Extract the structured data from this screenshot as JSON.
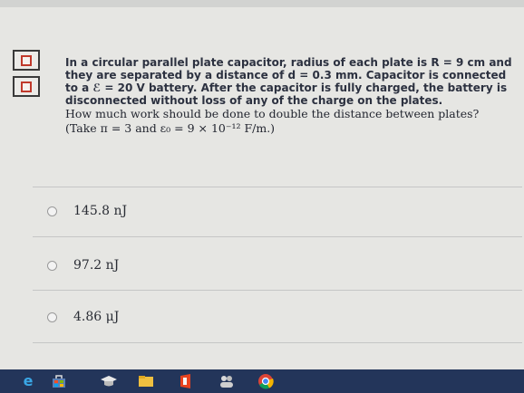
{
  "question": {
    "lines": [
      "In a circular parallel plate capacitor, radius of each plate is R = 9 cm and",
      "they are separated by a distance of d = 0.3 mm. Capacitor is connected",
      "to a ℰ = 20 V battery. After the capacitor is fully charged, the battery is",
      "disconnected without loss of any of the charge on the plates.",
      "How much work should be done to double the distance between plates?",
      "(Take π = 3 and ε₀ = 9 × 10⁻¹² F/m.)"
    ]
  },
  "options": [
    {
      "label": "145.8 nJ"
    },
    {
      "label": "97.2 nJ"
    },
    {
      "label": "4.86 μJ"
    }
  ],
  "taskbar": {
    "icons": [
      "edge-icon",
      "store-icon",
      "graduation-cap-icon",
      "file-explorer-icon",
      "office-icon",
      "people-icon",
      "chrome-icon"
    ]
  },
  "colors": {
    "background": "#e6e6e3",
    "taskbar": "#23355a",
    "marker_red": "#c0392b"
  }
}
